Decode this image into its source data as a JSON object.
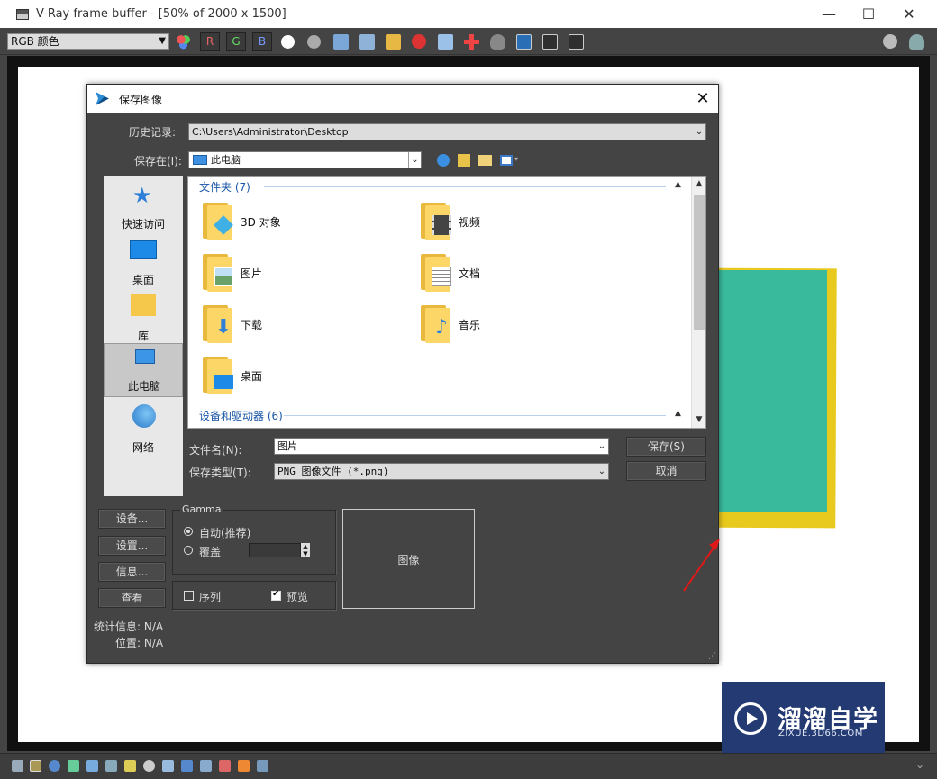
{
  "window": {
    "title": "V-Ray frame buffer - [50% of 2000 x 1500]",
    "controls": [
      "—",
      "☐",
      "✕"
    ]
  },
  "toolbar": {
    "channel": "RGB 颜色",
    "channel_letters": [
      "R",
      "G",
      "B"
    ]
  },
  "dialog": {
    "title": "保存图像",
    "close": "✕",
    "history_label": "历史记录:",
    "history_value": "C:\\Users\\Administrator\\Desktop",
    "savein_label": "保存在(I):",
    "savein_value": "此电脑",
    "places": [
      {
        "label": "快速访问"
      },
      {
        "label": "桌面"
      },
      {
        "label": "库"
      },
      {
        "label": "此电脑"
      },
      {
        "label": "网络"
      }
    ],
    "groups": [
      {
        "header": "文件夹 (7)"
      },
      {
        "header": "设备和驱动器 (6)"
      }
    ],
    "folders": [
      {
        "name": "3D 对象"
      },
      {
        "name": "视频"
      },
      {
        "name": "图片"
      },
      {
        "name": "文档"
      },
      {
        "name": "下载"
      },
      {
        "name": "音乐"
      },
      {
        "name": "桌面"
      }
    ],
    "filename_label": "文件名(N):",
    "filename_value": "图片",
    "filetype_label": "保存类型(T):",
    "filetype_value": "PNG 图像文件 (*.png)",
    "save_button": "保存(S)",
    "cancel_button": "取消",
    "side_buttons": [
      "设备...",
      "设置...",
      "信息...",
      "查看"
    ],
    "gamma_title": "Gamma",
    "gamma_auto": "自动(推荐)",
    "gamma_override": "覆盖",
    "sequence_label": "序列",
    "preview_label": "预览",
    "preview_text": "图像",
    "stats_label": "统计信息: N/A",
    "location_label": "位置: N/A"
  },
  "watermark": {
    "name": "溜溜自学",
    "sub": "ZIXUE.3D66.COM"
  }
}
